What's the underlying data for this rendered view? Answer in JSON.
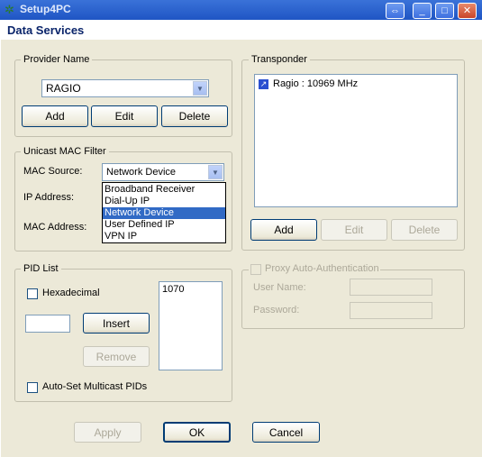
{
  "background_window": {
    "title": "Setup4PC"
  },
  "dialog": {
    "title": "Data Services"
  },
  "provider": {
    "group_label": "Provider Name",
    "selected": "RAGIO",
    "add": "Add",
    "edit": "Edit",
    "delete": "Delete"
  },
  "unicast": {
    "group_label": "Unicast MAC Filter",
    "mac_source_label": "MAC Source:",
    "mac_source_value": "Network Device",
    "ip_address_label": "IP Address:",
    "mac_address_label": "MAC Address:",
    "options": [
      "Broadband Receiver",
      "Dial-Up IP",
      "Network Device",
      "User Defined IP",
      "VPN IP"
    ],
    "selected_option": "Network Device"
  },
  "pid": {
    "group_label": "PID List",
    "hexadecimal": "Hexadecimal",
    "insert": "Insert",
    "remove": "Remove",
    "items": [
      "1070"
    ],
    "auto_set": "Auto-Set Multicast PIDs"
  },
  "transponder": {
    "group_label": "Transponder",
    "items": [
      "Ragio : 10969 MHz"
    ],
    "add": "Add",
    "edit": "Edit",
    "delete": "Delete"
  },
  "proxy": {
    "group_label": "Proxy Auto-Authentication",
    "user_name": "User Name:",
    "password": "Password:"
  },
  "footer": {
    "apply": "Apply",
    "ok": "OK",
    "cancel": "Cancel"
  }
}
